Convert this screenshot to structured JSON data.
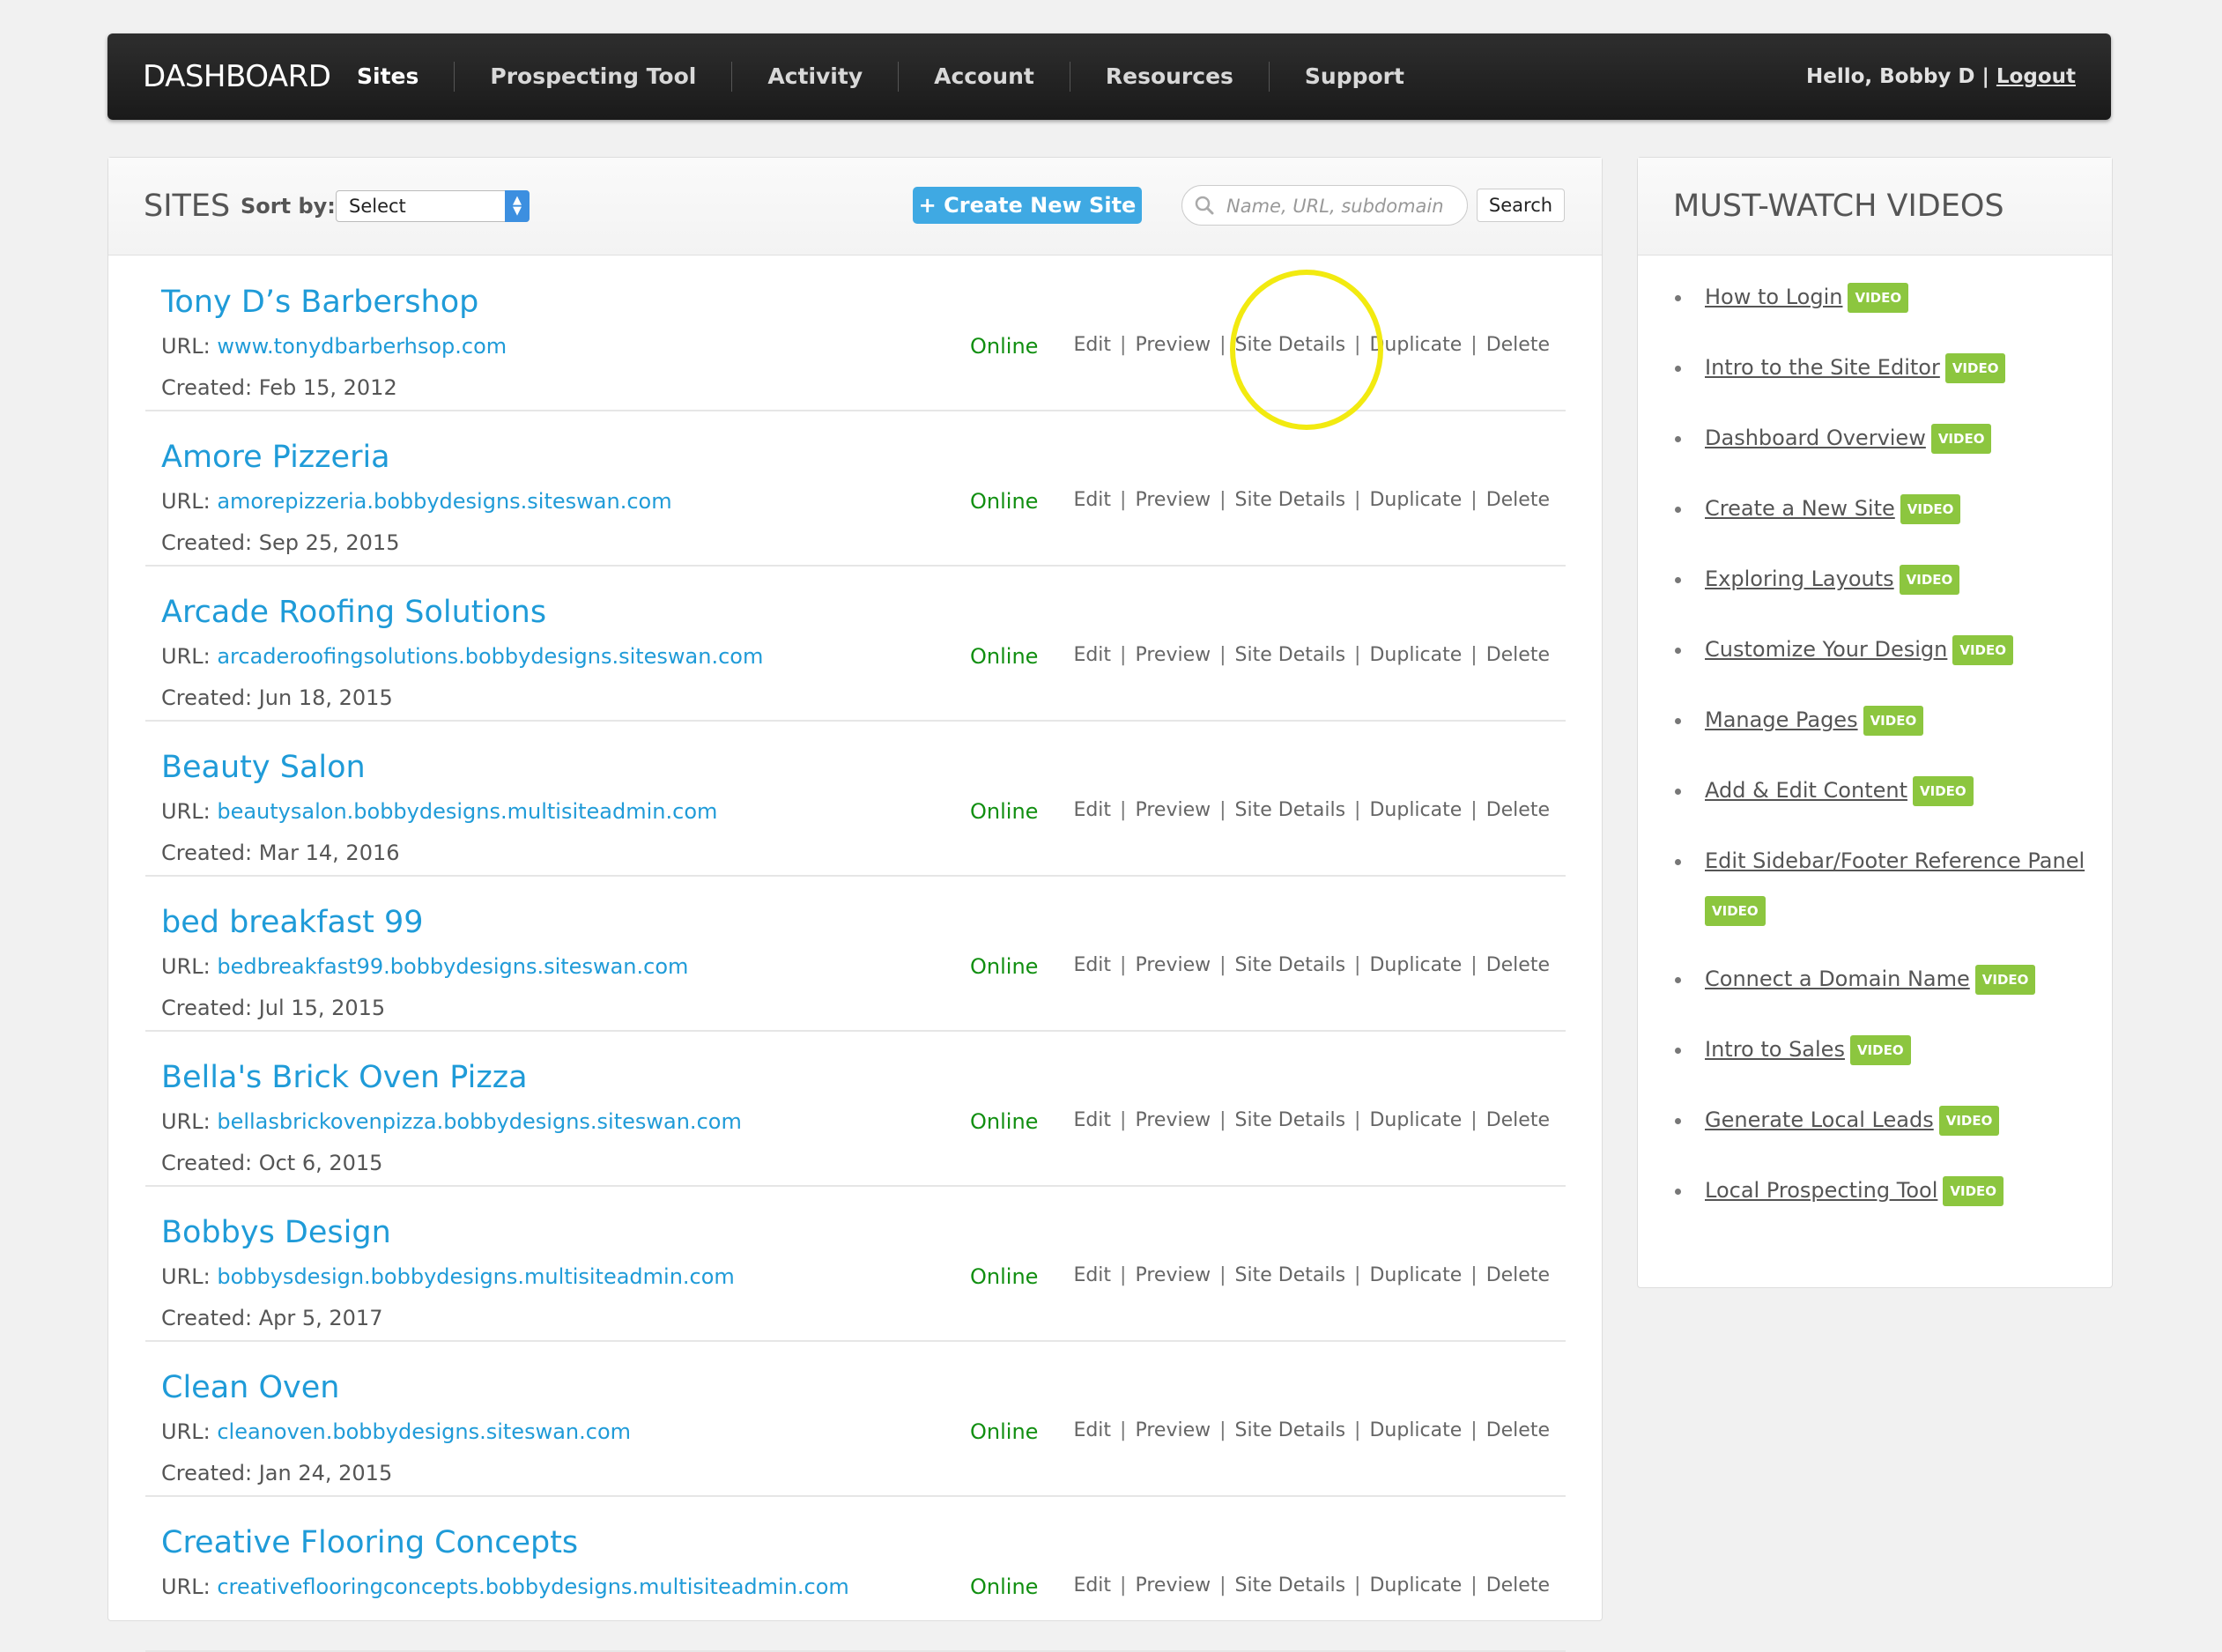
{
  "header": {
    "brand": "DASHBOARD",
    "nav": [
      "Sites",
      "Prospecting Tool",
      "Activity",
      "Account",
      "Resources",
      "Support"
    ],
    "greeting": "Hello, Bobby D",
    "separator": "|",
    "logout": "Logout"
  },
  "sites_panel": {
    "title": "SITES",
    "sort_label": "Sort by:",
    "sort_value": "Select",
    "create_button": "+ Create New Site",
    "search_placeholder": "Name, URL, subdomain",
    "search_button": "Search",
    "url_label": "URL:",
    "created_label": "Created:",
    "actions": [
      "Edit",
      "Preview",
      "Site Details",
      "Duplicate",
      "Delete"
    ],
    "sites": [
      {
        "name": "Tony D’s Barbershop",
        "url": "www.tonydbarberhsop.com",
        "created": "Feb 15, 2012",
        "status": "Online"
      },
      {
        "name": "Amore Pizzeria",
        "url": "amorepizzeria.bobbydesigns.siteswan.com",
        "created": "Sep 25, 2015",
        "status": "Online"
      },
      {
        "name": "Arcade Roofing Solutions",
        "url": "arcaderoofingsolutions.bobbydesigns.siteswan.com",
        "created": "Jun 18, 2015",
        "status": "Online"
      },
      {
        "name": "Beauty Salon",
        "url": "beautysalon.bobbydesigns.multisiteadmin.com",
        "created": "Mar 14, 2016",
        "status": "Online"
      },
      {
        "name": "bed breakfast 99",
        "url": "bedbreakfast99.bobbydesigns.siteswan.com",
        "created": "Jul 15, 2015",
        "status": "Online"
      },
      {
        "name": "Bella's Brick Oven Pizza",
        "url": "bellasbrickovenpizza.bobbydesigns.siteswan.com",
        "created": "Oct 6, 2015",
        "status": "Online"
      },
      {
        "name": "Bobbys Design",
        "url": "bobbysdesign.bobbydesigns.multisiteadmin.com",
        "created": "Apr 5, 2017",
        "status": "Online"
      },
      {
        "name": "Clean Oven",
        "url": "cleanoven.bobbydesigns.siteswan.com",
        "created": "Jan 24, 2015",
        "status": "Online"
      },
      {
        "name": "Creative Flooring Concepts",
        "url": "creativeflooringconcepts.bobbydesigns.multisiteadmin.com",
        "created": "",
        "status": "Online"
      }
    ]
  },
  "videos_panel": {
    "title": "MUST-WATCH VIDEOS",
    "badge": "VIDEO",
    "items": [
      "How to Login",
      "Intro to the Site Editor",
      "Dashboard Overview",
      "Create a New Site",
      "Exploring Layouts",
      "Customize Your Design",
      "Manage Pages",
      "Add & Edit Content",
      "Edit Sidebar/Footer Reference Panel",
      "Connect a Domain Name",
      "Intro to Sales",
      "Generate Local Leads",
      "Local Prospecting Tool"
    ]
  },
  "colors": {
    "link": "#1f9bd8",
    "online": "#118f11",
    "badge": "#8cc63f",
    "create_button": "#3fa9e3",
    "highlight": "#f2ea10"
  }
}
